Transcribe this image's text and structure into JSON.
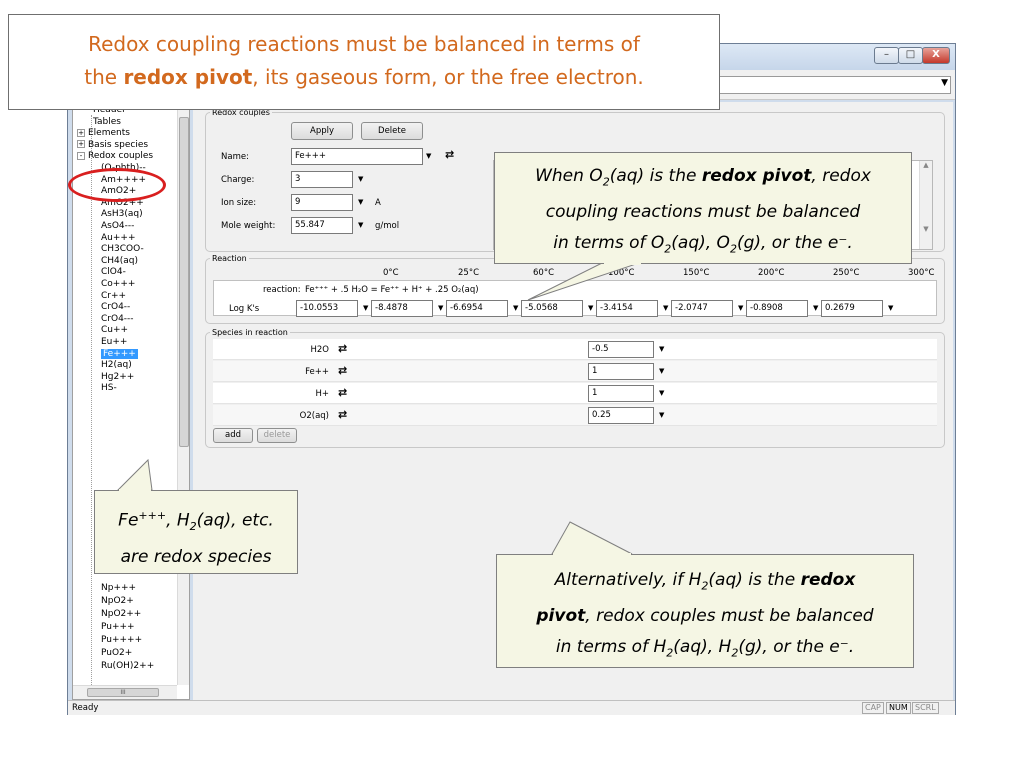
{
  "title_callout": {
    "line1": "Redox coupling reactions must be balanced in terms of",
    "line2_pre": "the ",
    "line2_bold": "redox pivot",
    "line2_post": ", its gaseous form, or the free electron."
  },
  "callouts": {
    "o2": {
      "l1a": "When O",
      "l1sub": "2",
      "l1b": "(aq) is the ",
      "l1bold": "redox pivot",
      "l1c": ", redox",
      "l2": "coupling reactions must be balanced",
      "l3a": "in terms of O",
      "l3sub1": "2",
      "l3b": "(aq), O",
      "l3sub2": "2",
      "l3c": "(g), or the e⁻."
    },
    "fe": {
      "l1a": "Fe",
      "l1sup": "+++",
      "l1b": ", H",
      "l1sub": "2",
      "l1c": "(aq), etc.",
      "l2": "are redox species"
    },
    "h2": {
      "l1a": "Alternatively, if H",
      "l1sub": "2",
      "l1b": "(aq) is the ",
      "l1bold": "redox",
      "l2bold": "pivot",
      "l2b": ", redox couples must be balanced",
      "l3a": "in terms of H",
      "l3sub1": "2",
      "l3b": "(aq), H",
      "l3sub2": "2",
      "l3c": "(g), or the e⁻."
    }
  },
  "window": {
    "btn_min": "–",
    "btn_max": "□",
    "btn_close": "X",
    "combo_arrow": "▼",
    "status": "Ready",
    "indicators": [
      "CAP",
      "NUM",
      "SCRL"
    ],
    "active_indicator": "NUM"
  },
  "tree": {
    "items": [
      {
        "label": "Header",
        "indent": 1
      },
      {
        "label": "Tables",
        "indent": 1
      },
      {
        "label": "Elements",
        "indent": 0,
        "expander": "+"
      },
      {
        "label": "Basis species",
        "indent": 0,
        "expander": "+"
      },
      {
        "label": "Redox couples",
        "indent": 0,
        "expander": "-"
      },
      {
        "label": "(O-phth)--",
        "indent": 2
      },
      {
        "label": "Am++++",
        "indent": 2
      },
      {
        "label": "AmO2+",
        "indent": 2
      },
      {
        "label": "AmO2++",
        "indent": 2
      },
      {
        "label": "AsH3(aq)",
        "indent": 2
      },
      {
        "label": "AsO4---",
        "indent": 2
      },
      {
        "label": "Au+++",
        "indent": 2
      },
      {
        "label": "CH3COO-",
        "indent": 2
      },
      {
        "label": "CH4(aq)",
        "indent": 2
      },
      {
        "label": "ClO4-",
        "indent": 2
      },
      {
        "label": "Co+++",
        "indent": 2
      },
      {
        "label": "Cr++",
        "indent": 2
      },
      {
        "label": "CrO4--",
        "indent": 2
      },
      {
        "label": "CrO4---",
        "indent": 2
      },
      {
        "label": "Cu++",
        "indent": 2
      },
      {
        "label": "Eu++",
        "indent": 2
      },
      {
        "label": "Fe+++",
        "indent": 2,
        "selected": true
      },
      {
        "label": "H2(aq)",
        "indent": 2
      },
      {
        "label": "Hg2++",
        "indent": 2
      },
      {
        "label": "HS-",
        "indent": 2
      }
    ],
    "items_bottom": [
      {
        "label": "Np+++",
        "indent": 2
      },
      {
        "label": "NpO2+",
        "indent": 2
      },
      {
        "label": "NpO2++",
        "indent": 2
      },
      {
        "label": "Pu+++",
        "indent": 2
      },
      {
        "label": "Pu++++",
        "indent": 2
      },
      {
        "label": "PuO2+",
        "indent": 2
      },
      {
        "label": "Ru(OH)2++",
        "indent": 2
      }
    ],
    "scroll_mark": "III"
  },
  "redox": {
    "legend": "Redox couples",
    "apply": "Apply",
    "delete": "Delete",
    "name_label": "Name:",
    "name_value": "Fe+++",
    "charge_label": "Charge:",
    "charge_value": "3",
    "ionsize_label": "Ion size:",
    "ionsize_value": "9",
    "ionsize_unit": "A",
    "mw_label": "Mole weight:",
    "mw_value": "55.847",
    "mw_unit": "g/mol"
  },
  "reaction": {
    "legend": "Reaction",
    "temps": [
      "0°C",
      "25°C",
      "60°C",
      "100°C",
      "150°C",
      "200°C",
      "250°C",
      "300°C"
    ],
    "reaction_label": "reaction:",
    "reaction_text": "Fe⁺⁺⁺ + .5 H₂O = Fe⁺⁺ + H⁺ + .25 O₂(aq)",
    "logk_label": "Log K's",
    "logk": [
      "-10.0553",
      "-8.4878",
      "-6.6954",
      "-5.0568",
      "-3.4154",
      "-2.0747",
      "-0.8908",
      "0.2679"
    ]
  },
  "species": {
    "legend": "Species in reaction",
    "rows": [
      {
        "name": "H2O",
        "coef": "-0.5"
      },
      {
        "name": "Fe++",
        "coef": "1"
      },
      {
        "name": "H+",
        "coef": "1"
      },
      {
        "name": "O2(aq)",
        "coef": "0.25"
      }
    ],
    "add": "add",
    "delete": "delete"
  }
}
